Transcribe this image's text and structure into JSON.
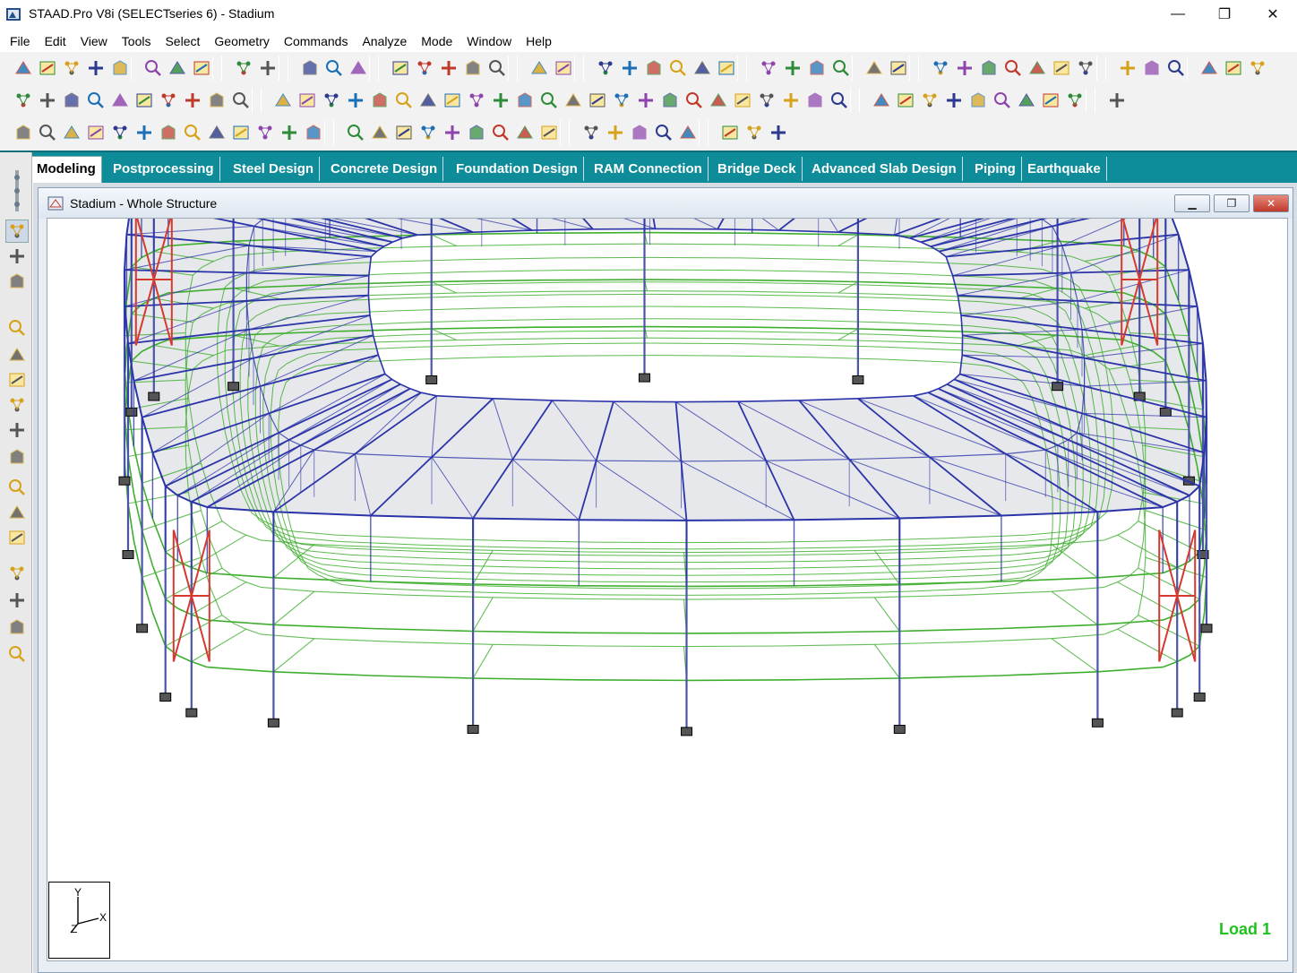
{
  "window": {
    "title": "STAAD.Pro V8i (SELECTseries 6)  - Stadium",
    "minimize": "—",
    "maximize": "❐",
    "close": "✕"
  },
  "menu": [
    "File",
    "Edit",
    "View",
    "Tools",
    "Select",
    "Geometry",
    "Commands",
    "Analyze",
    "Mode",
    "Window",
    "Help"
  ],
  "tabs": [
    {
      "label": "Modeling",
      "active": true
    },
    {
      "label": "Postprocessing"
    },
    {
      "label": "Steel Design"
    },
    {
      "label": "Concrete Design"
    },
    {
      "label": "Foundation Design"
    },
    {
      "label": "RAM Connection"
    },
    {
      "label": "Bridge Deck"
    },
    {
      "label": "Advanced Slab Design"
    },
    {
      "label": "Piping"
    },
    {
      "label": "Earthquake"
    }
  ],
  "child_window": {
    "title": "Stadium - Whole Structure",
    "minimize": "▁",
    "restore": "❐",
    "close": "✕"
  },
  "viewport": {
    "load_label": "Load 1",
    "axes": {
      "y": "Y",
      "x": "X",
      "z": "Z"
    },
    "colors": {
      "roof_truss": "#2b34a8",
      "floor_beam": "#3fae2f",
      "bracing": "#d43a2f",
      "column": "#4b55a8",
      "support": "#333333",
      "load_label": "#1fc21f"
    }
  },
  "icons": {
    "app": "staad-app-icon",
    "child": "structure-window-icon"
  }
}
